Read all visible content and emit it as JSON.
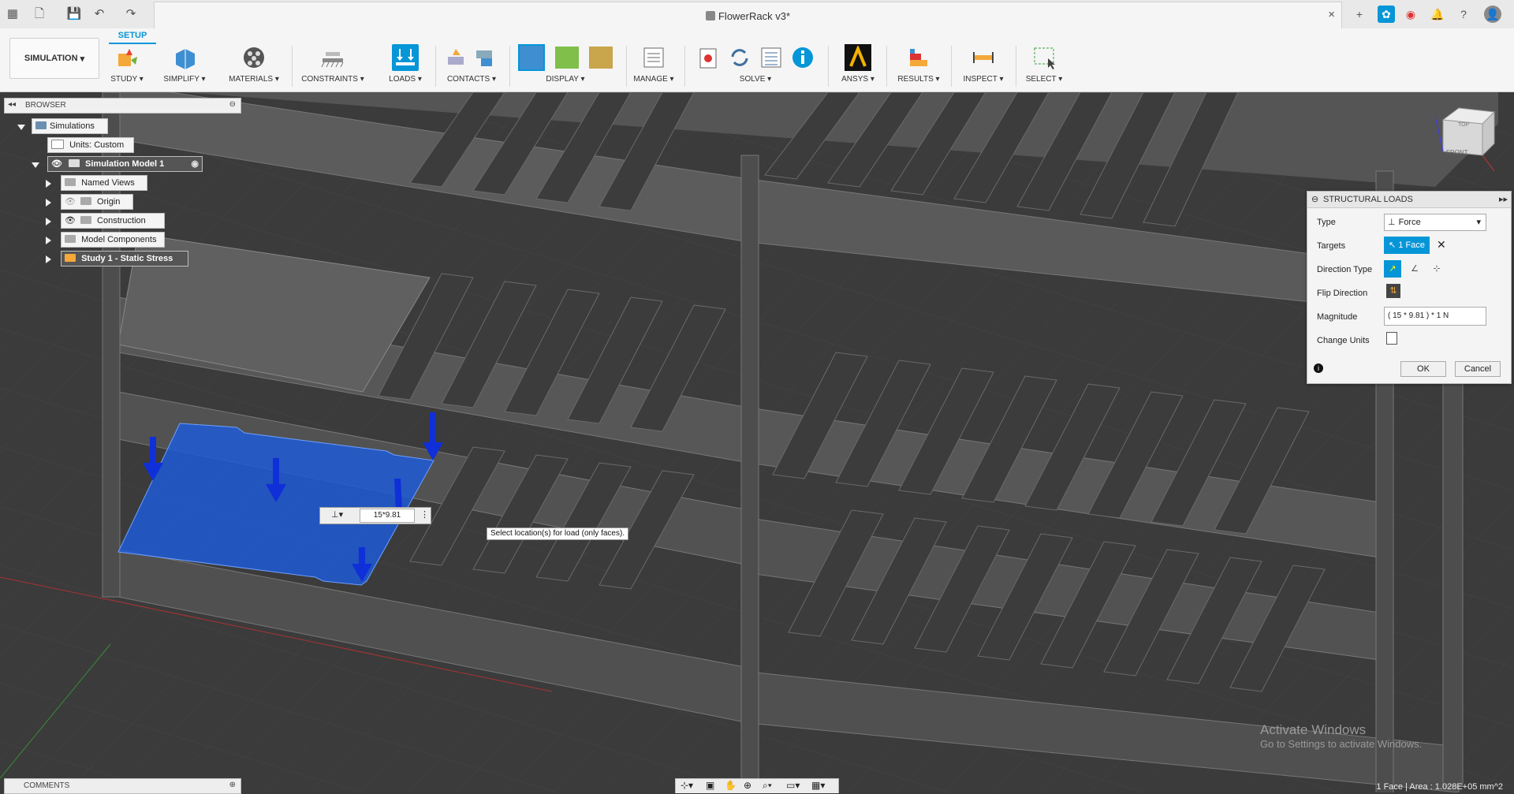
{
  "title_bar": {
    "document_title": "FlowerRack v3*",
    "close_glyph": "×",
    "right_icons": [
      "add-tab-icon",
      "extensions-icon",
      "job-status-icon",
      "notifications-icon",
      "help-icon",
      "user-avatar-icon"
    ]
  },
  "ribbon": {
    "workspace": "SIMULATION",
    "active_tab": "SETUP",
    "groups": [
      {
        "label": "STUDY",
        "icon": "study-icon"
      },
      {
        "label": "SIMPLIFY",
        "icon": "simplify-icon"
      },
      {
        "label": "MATERIALS",
        "icon": "materials-icon"
      },
      {
        "label": "CONSTRAINTS",
        "icon": "constraints-icon"
      },
      {
        "label": "LOADS",
        "icon": "loads-icon"
      },
      {
        "label": "CONTACTS",
        "icon": "contacts-icon"
      },
      {
        "label": "DISPLAY",
        "icon": "display-icon"
      },
      {
        "label": "MANAGE",
        "icon": "manage-icon"
      },
      {
        "label": "SOLVE",
        "icon": "solve-icon"
      },
      {
        "label": "ANSYS",
        "icon": "ansys-icon"
      },
      {
        "label": "RESULTS",
        "icon": "results-icon"
      },
      {
        "label": "INSPECT",
        "icon": "inspect-icon"
      },
      {
        "label": "SELECT",
        "icon": "select-icon"
      }
    ],
    "accent_color": "#0696d7"
  },
  "browser": {
    "header": "BROWSER",
    "nodes": [
      {
        "label": "Simulations"
      },
      {
        "label": "Units: Custom"
      },
      {
        "label": "Simulation Model 1"
      },
      {
        "label": "Named Views"
      },
      {
        "label": "Origin"
      },
      {
        "label": "Construction"
      },
      {
        "label": "Model Components"
      },
      {
        "label": "Study 1 - Static Stress"
      }
    ]
  },
  "structural_loads": {
    "title": "STRUCTURAL LOADS",
    "type_label": "Type",
    "type_value": "Force",
    "targets_label": "Targets",
    "targets_value": "1 Face",
    "direction_type_label": "Direction Type",
    "flip_direction_label": "Flip Direction",
    "magnitude_label": "Magnitude",
    "magnitude_value": "( 15 * 9.81 ) * 1 N",
    "change_units_label": "Change Units",
    "ok_label": "OK",
    "cancel_label": "Cancel"
  },
  "viewport": {
    "inline_magnitude": "15*9.81",
    "tooltip": "Select location(s) for load (only faces).",
    "selected_face_color": "#1e5bd6",
    "load_arrow_color": "#0f2fd8",
    "viewcube_top": "TOP",
    "viewcube_front": "FRONT"
  },
  "bottom": {
    "comments": "COMMENTS",
    "status": "1 Face | Area : 1.028E+05 mm^2",
    "activate_title": "Activate Windows",
    "activate_sub": "Go to Settings to activate Windows."
  }
}
